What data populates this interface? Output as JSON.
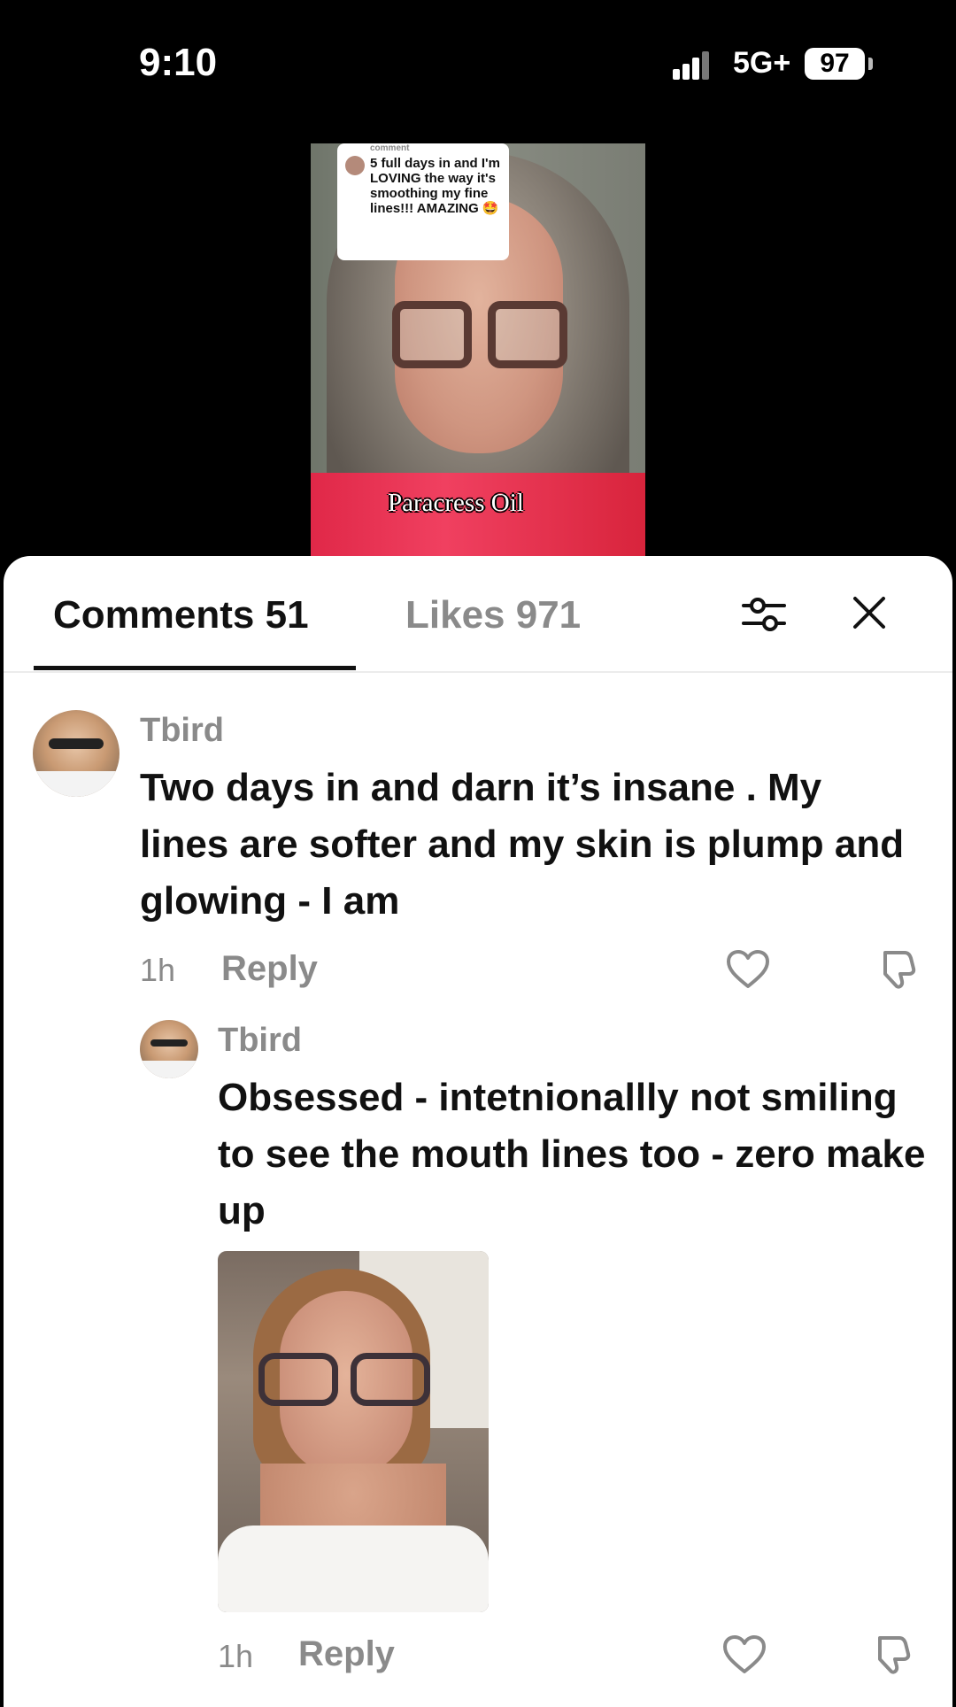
{
  "status_bar": {
    "time": "9:10",
    "network": "5G+",
    "battery": "97"
  },
  "video": {
    "overlay_tag": "comment",
    "overlay_text": "5 full days in and I'm LOVING the way it's smoothing my fine lines!!! AMAZING 🤩",
    "caption": "Paracress Oil"
  },
  "tabs": {
    "comments": "Comments 51",
    "likes": "Likes 971"
  },
  "icons": {
    "filter": "filter-icon",
    "close": "close-icon",
    "like": "heart-icon",
    "dislike": "dislike-icon"
  },
  "comments": [
    {
      "username": "Tbird",
      "text": "Two days in and darn it’s insane . My lines are softer and my skin is plump and glowing - I am",
      "time": "1h",
      "reply_label": "Reply"
    },
    {
      "username": "Tbird",
      "text": "Obsessed - intetnionallly not smiling to see the mouth lines too - zero make up",
      "time": "1h",
      "reply_label": "Reply"
    }
  ]
}
